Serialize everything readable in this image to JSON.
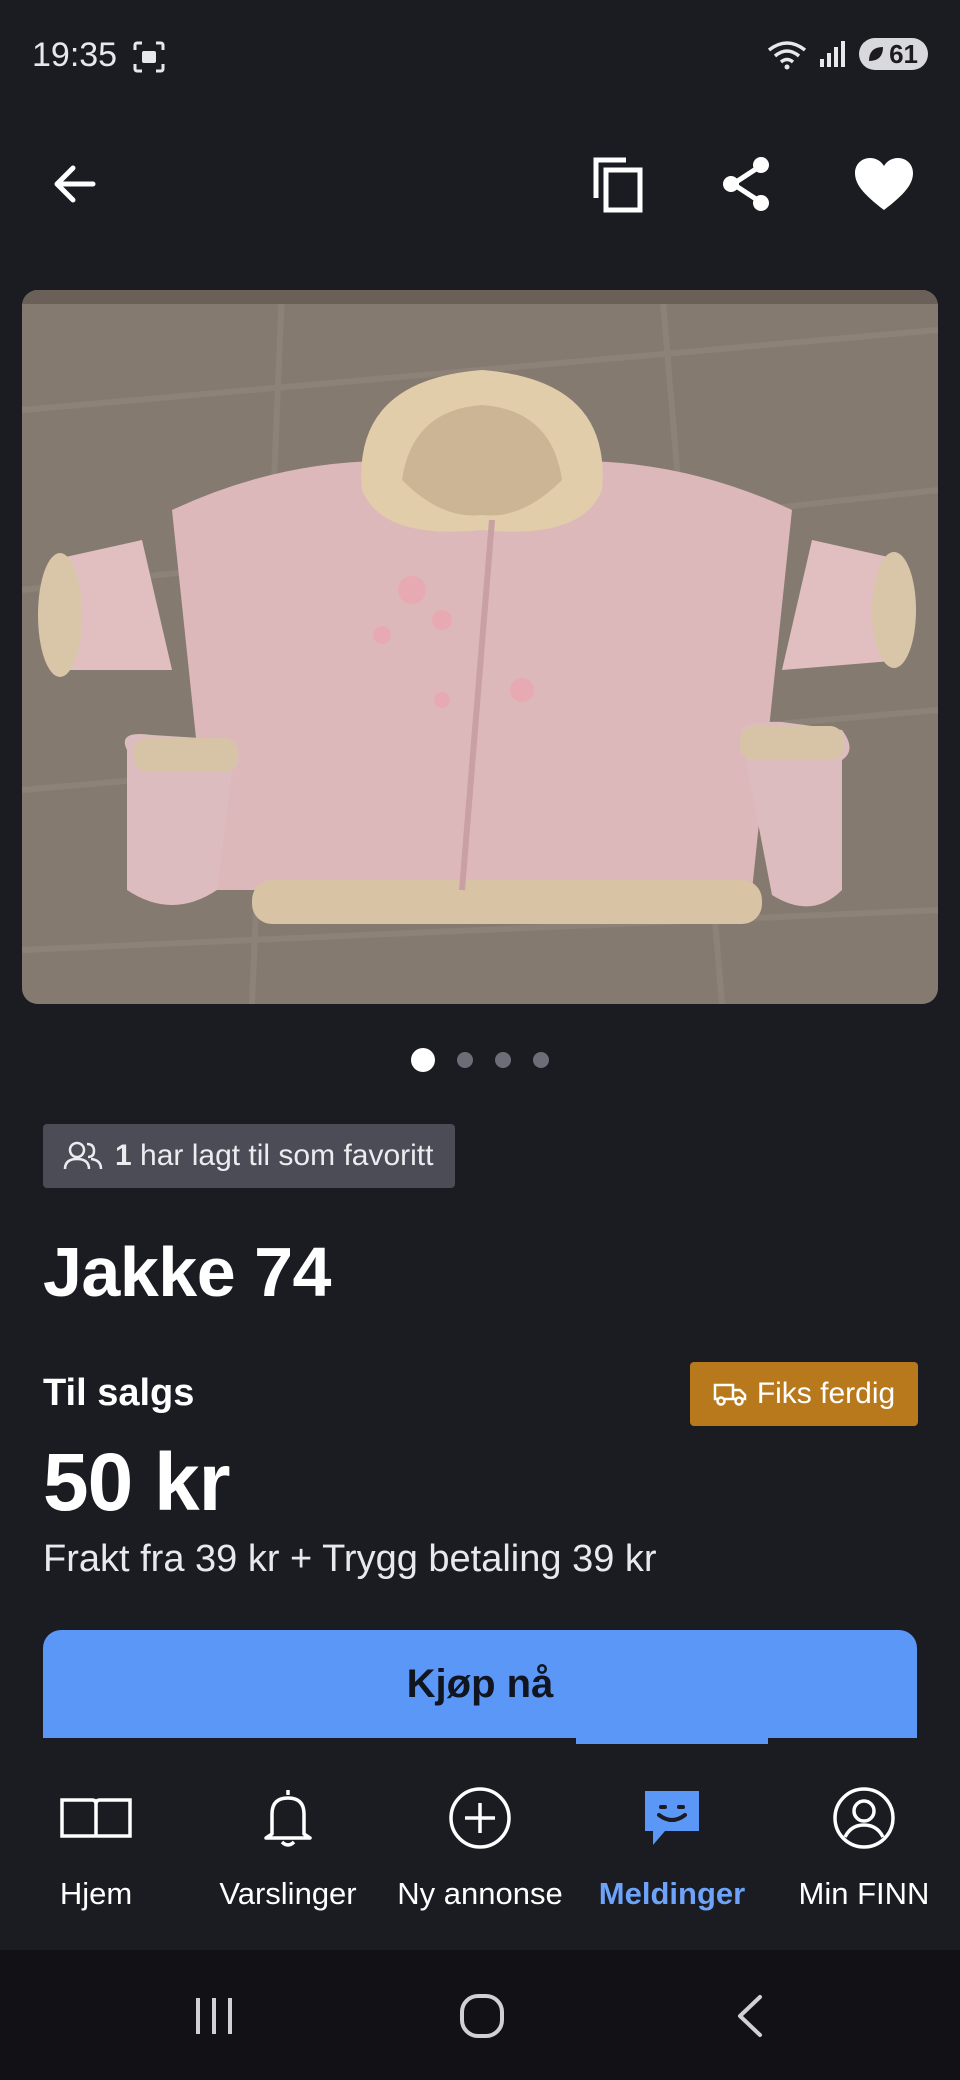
{
  "status_bar": {
    "time": "19:35",
    "battery": "61"
  },
  "listing": {
    "favorites_count": "1",
    "favorites_text": "har lagt til som favoritt",
    "title": "Jakke 74",
    "sale_label": "Til salgs",
    "badge": "Fiks ferdig",
    "price": "50 kr",
    "shipping": "Frakt fra 39 kr + Trygg betaling 39 kr",
    "buy_button": "Kjøp nå",
    "image_count": 4,
    "current_image": 1
  },
  "bottom_nav": {
    "items": [
      {
        "label": "Hjem",
        "icon": "book-icon"
      },
      {
        "label": "Varslinger",
        "icon": "bell-icon"
      },
      {
        "label": "Ny annonse",
        "icon": "plus-circle-icon"
      },
      {
        "label": "Meldinger",
        "icon": "chat-icon",
        "active": true
      },
      {
        "label": "Min FINN",
        "icon": "profile-icon"
      }
    ]
  },
  "colors": {
    "background": "#1b1b22",
    "accent": "#5b97f7",
    "badge_orange": "#b8791c",
    "badge_grey": "#4b4c56"
  }
}
